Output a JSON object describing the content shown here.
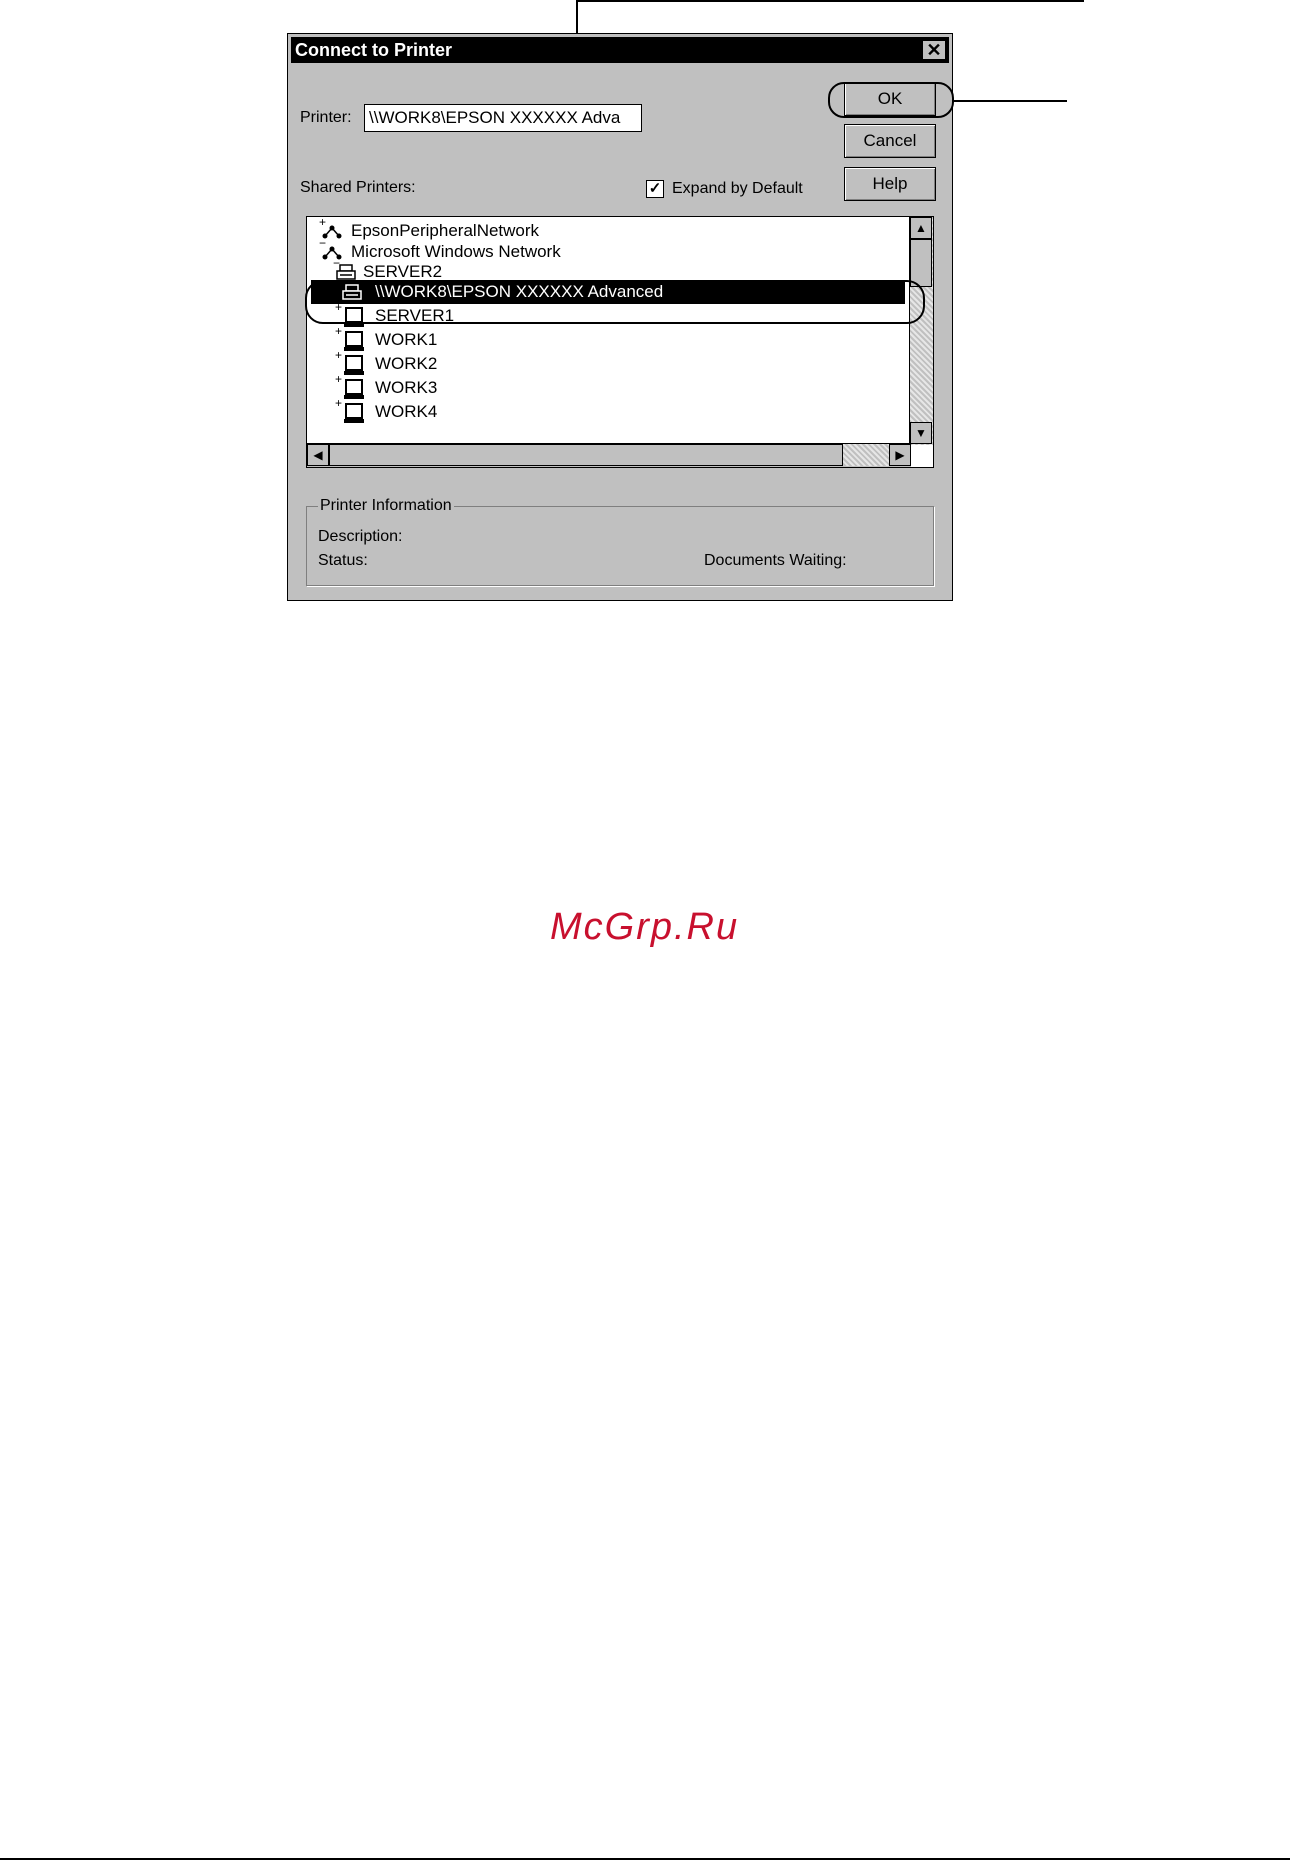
{
  "dialog": {
    "title": "Connect to Printer",
    "close_symbol": "✕",
    "printer_label": "Printer:",
    "printer_value": "\\\\WORK8\\EPSON XXXXXX Adva",
    "shared_printers_label": "Shared Printers:",
    "expand_by_default_label": "Expand by Default",
    "expand_by_default_checked": true,
    "buttons": {
      "ok": "OK",
      "cancel": "Cancel",
      "help": "Help"
    },
    "tree": {
      "items": [
        {
          "label": "EpsonPeripheralNetwork",
          "icon": "network-icon"
        },
        {
          "label": "Microsoft Windows Network",
          "icon": "network-icon"
        },
        {
          "label": "SERVER2",
          "icon": "printer-icon"
        },
        {
          "label": "\\\\WORK8\\EPSON XXXXXX Advanced",
          "icon": "printer-icon",
          "selected": true
        },
        {
          "label": "SERVER1",
          "icon": "computer-icon"
        },
        {
          "label": "WORK1",
          "icon": "computer-icon"
        },
        {
          "label": "WORK2",
          "icon": "computer-icon"
        },
        {
          "label": "WORK3",
          "icon": "computer-icon"
        },
        {
          "label": "WORK4",
          "icon": "computer-icon"
        }
      ]
    },
    "printer_info": {
      "legend": "Printer Information",
      "description_label": "Description:",
      "status_label": "Status:",
      "documents_waiting_label": "Documents Waiting:"
    }
  },
  "watermark": "McGrp.Ru"
}
